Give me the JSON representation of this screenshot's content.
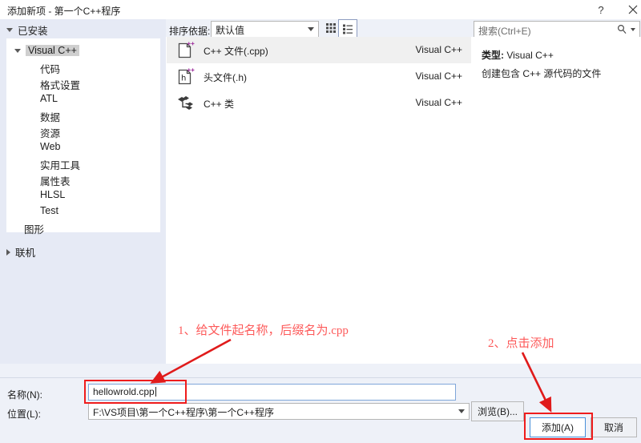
{
  "window": {
    "title": "添加新项 - 第一个C++程序",
    "help_icon": "?",
    "close_icon": "close-icon"
  },
  "sidebar": {
    "root_label": "已安装",
    "root_expanded": true,
    "selected": "Visual C++",
    "items": [
      {
        "label": "Visual C++",
        "level": 1,
        "expanded": true,
        "selected": true
      },
      {
        "label": "代码",
        "level": 2
      },
      {
        "label": "格式设置",
        "level": 2
      },
      {
        "label": "ATL",
        "level": 2
      },
      {
        "label": "数据",
        "level": 2
      },
      {
        "label": "资源",
        "level": 2
      },
      {
        "label": "Web",
        "level": 2
      },
      {
        "label": "实用工具",
        "level": 2
      },
      {
        "label": "属性表",
        "level": 2
      },
      {
        "label": "HLSL",
        "level": 2
      },
      {
        "label": "Test",
        "level": 2
      },
      {
        "label": "图形",
        "level": 1
      }
    ],
    "online_label": "联机",
    "online_expanded": false
  },
  "toolbar": {
    "sort_label": "排序依据:",
    "sort_value": "默认值",
    "view_grid_icon": "grid-view-icon",
    "view_list_icon": "list-view-icon",
    "view_active": "list"
  },
  "search": {
    "placeholder": "搜索(Ctrl+E)",
    "icon": "search-icon"
  },
  "templates": [
    {
      "name": "C++ 文件(.cpp)",
      "source": "Visual C++",
      "icon": "cpp-file-icon",
      "selected": true
    },
    {
      "name": "头文件(.h)",
      "source": "Visual C++",
      "icon": "header-file-icon",
      "selected": false
    },
    {
      "name": "C++ 类",
      "source": "Visual C++",
      "icon": "cpp-class-icon",
      "selected": false
    }
  ],
  "details": {
    "type_label": "类型:",
    "type_value": "Visual C++",
    "description": "创建包含 C++ 源代码的文件"
  },
  "form": {
    "name_label": "名称(N):",
    "name_value": "hellowrold.cpp",
    "location_label": "位置(L):",
    "location_value": "F:\\VS项目\\第一个C++程序\\第一个C++程序",
    "browse_label": "浏览(B)...",
    "add_label": "添加(A)",
    "cancel_label": "取消"
  },
  "annotations": [
    {
      "id": "anno-1",
      "text": "1、给文件起名称，后缀名为.cpp"
    },
    {
      "id": "anno-2",
      "text": "2、点击添加"
    }
  ],
  "colors": {
    "annotation_red": "#fd5a5a",
    "highlight_box_red": "#ef1c1c",
    "panel_blue": "#e6eaf5",
    "focus_border": "#7fa6d9"
  }
}
